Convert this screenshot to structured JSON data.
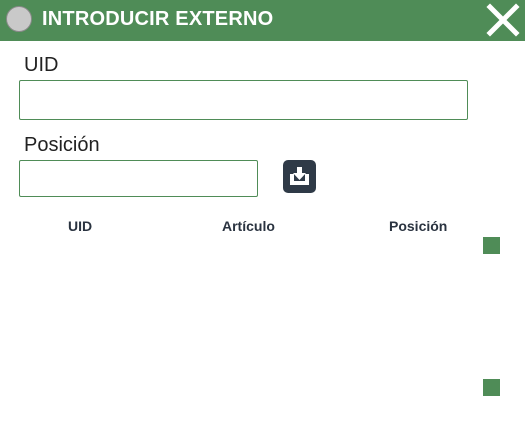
{
  "window": {
    "title": "INTRODUCIR EXTERNO",
    "close_icon": "close-icon",
    "status_icon": "circle-icon"
  },
  "form": {
    "uid_label": "UID",
    "uid_value": "",
    "uid_placeholder": "",
    "position_label": "Posición",
    "position_value": "",
    "position_placeholder": "",
    "import_icon": "tray-download-icon"
  },
  "table": {
    "columns": [
      "UID",
      "Artículo",
      "Posición"
    ],
    "rows": []
  },
  "colors": {
    "accent": "#4f8c57",
    "button_dark": "#2f3a47"
  }
}
